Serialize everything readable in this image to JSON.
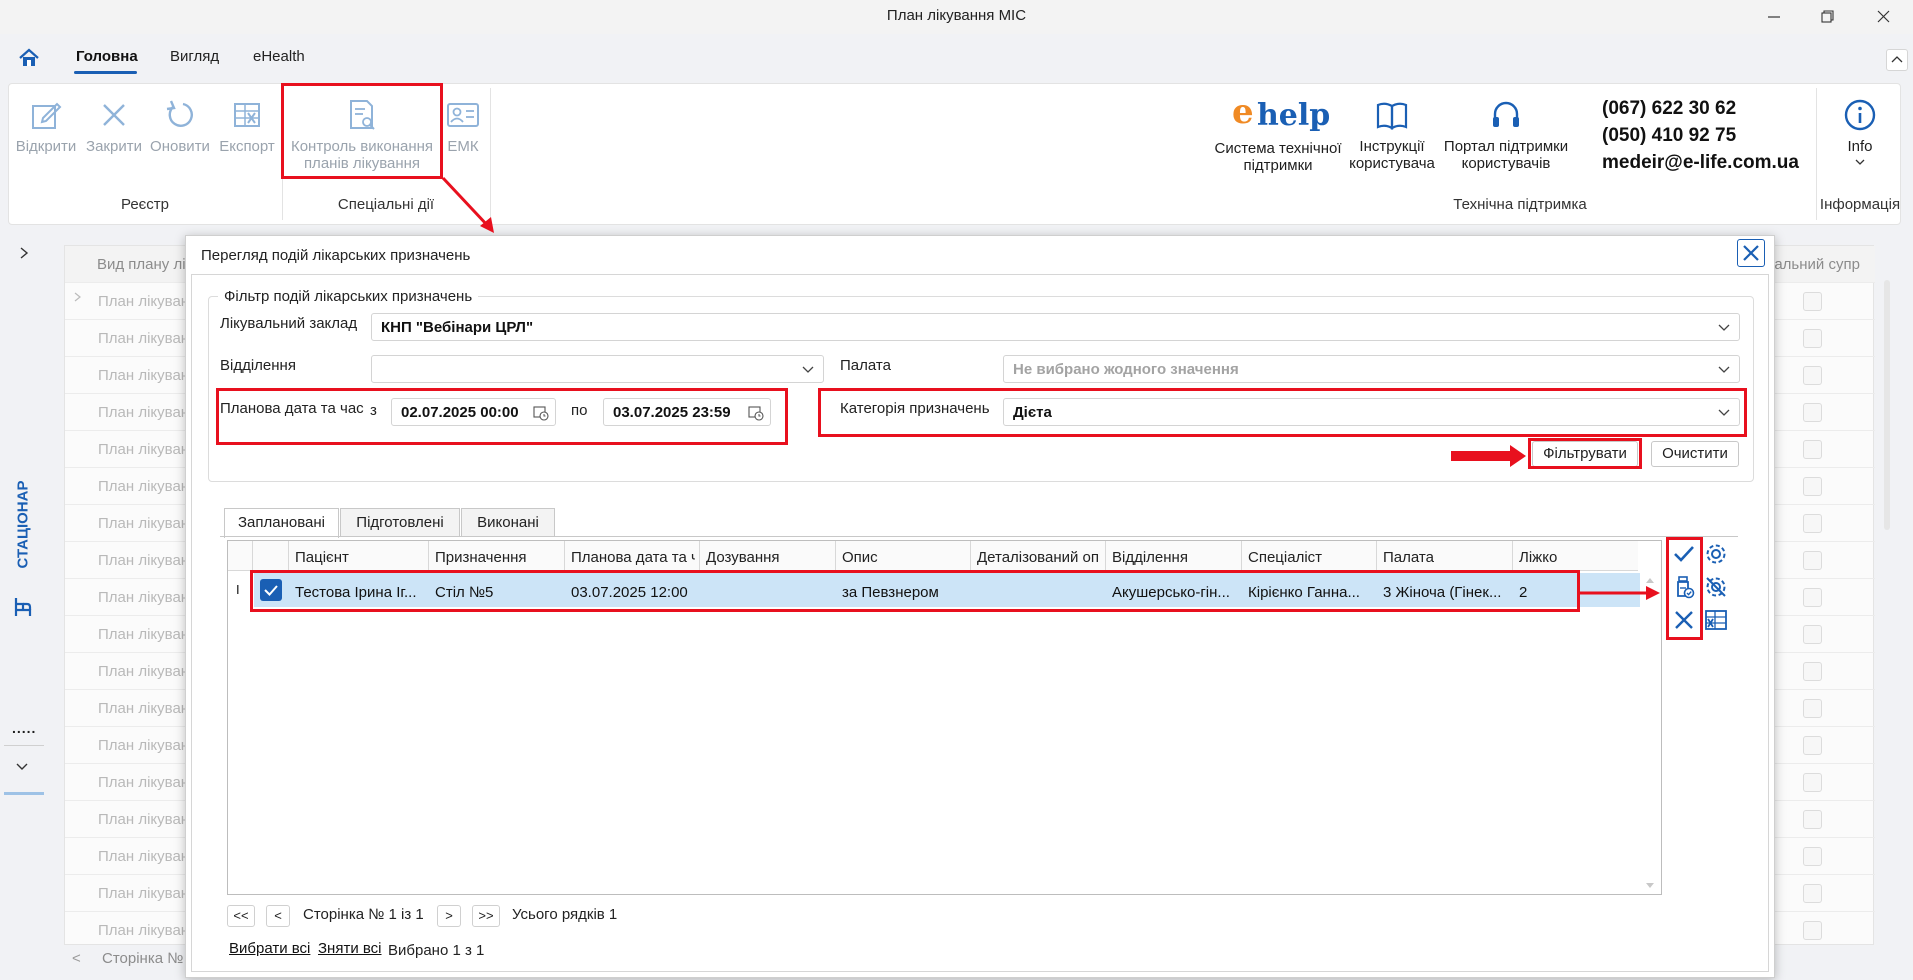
{
  "window": {
    "title": "План лікування МІС"
  },
  "menu": {
    "tabs": [
      "Головна",
      "Вигляд",
      "eHealth"
    ]
  },
  "ribbon": {
    "registry": {
      "buttons": [
        "Відкрити",
        "Закрити",
        "Оновити",
        "Експорт"
      ],
      "group_label": "Реєстр"
    },
    "special": {
      "control_l1": "Контроль виконання",
      "control_l2": "планів лікування",
      "emk": "ЕМК",
      "group_label": "Спеціальні дії"
    },
    "support": {
      "ehelp_l1": "Система технічної",
      "ehelp_l2": "підтримки",
      "manual_l1": "Інструкції",
      "manual_l2": "користувача",
      "portal_l1": "Портал підтримки",
      "portal_l2": "користувачів",
      "group_label": "Технічна підтримка"
    },
    "contacts": {
      "phone1": "(067) 622 30 62",
      "phone2": "(050) 410 92 75",
      "email": "medeir@e-life.com.ua"
    },
    "info": {
      "label": "Info",
      "group_label": "Інформація"
    },
    "ehelp_logo": {
      "e": "e",
      "help": "help"
    }
  },
  "side": {
    "module_label": "СТАЦІОНАР",
    "dots": "....."
  },
  "background": {
    "col1_header": "Вид плану лі",
    "col_right_header": "іальний супр",
    "row_text": "План лікуван",
    "pager_text": "Сторінка №"
  },
  "dialog": {
    "title": "Перегляд подій лікарських призначень",
    "filter": {
      "group_label": "Фільтр подій лікарських призначень",
      "facility_label": "Лікувальний заклад",
      "facility_value": "КНП \"Вебінари ЦРЛ\"",
      "department_label": "Відділення",
      "department_value": "",
      "ward_label": "Палата",
      "ward_placeholder": "Не вибрано жодного значення",
      "date_label": "Планова дата та час",
      "from_label": "з",
      "from_value": "02.07.2025 00:00",
      "to_label": "по",
      "to_value": "03.07.2025 23:59",
      "category_label": "Категорія призначень",
      "category_value": "Дієта",
      "filter_button": "Фільтрувати",
      "clear_button": "Очистити"
    },
    "tabs": [
      "Заплановані",
      "Підготовлені",
      "Виконані"
    ],
    "table": {
      "columns": [
        "Пацієнт",
        "Призначення",
        "Планова дата та ч",
        "Дозування",
        "Опис",
        "Деталізований оп",
        "Відділення",
        "Спеціаліст",
        "Палата",
        "Ліжко"
      ],
      "rows": [
        {
          "patient": "Тестова Ірина Іг...",
          "appointment": "Стіл №5",
          "date": "03.07.2025 12:00",
          "dosage": "",
          "description": "за Певзнером",
          "detailed": "",
          "department": "Акушерсько-гін...",
          "specialist": "Кірієнко Ганна...",
          "ward": "3 Жіноча (Гінек...",
          "bed": "2"
        }
      ],
      "row_marker": "I"
    },
    "pager": {
      "first": "<<",
      "prev": "<",
      "page_text": "Сторінка № 1 із 1",
      "next": ">",
      "last": ">>",
      "total": "Усього рядків 1"
    },
    "selection": {
      "select_all": "Вибрати всі",
      "deselect_all": "Зняти всі",
      "selected": "Вибрано 1 з 1"
    }
  },
  "colors": {
    "accent": "#1a5fb4",
    "highlight": "#e8101e",
    "row_selected": "#cce4f7",
    "ehelp_orange": "#f08a24"
  }
}
